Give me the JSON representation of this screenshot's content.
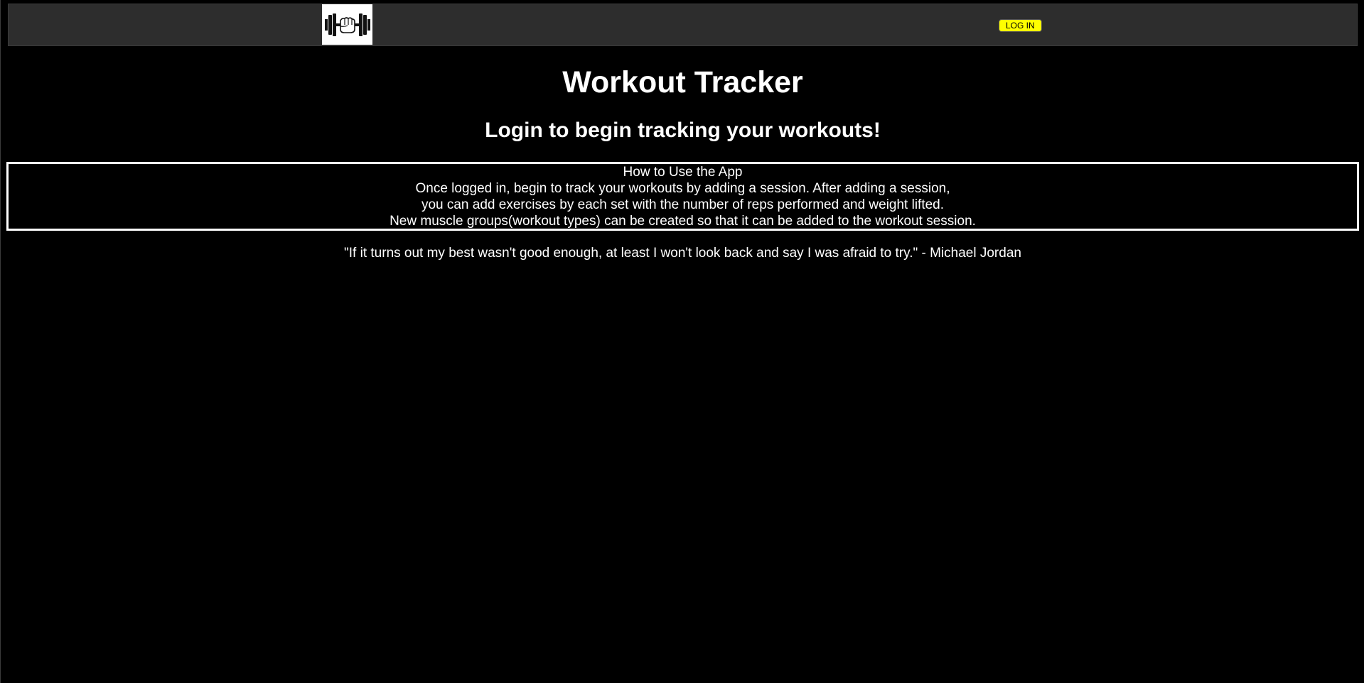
{
  "navbar": {
    "logo_icon": "dumbbell-fist-icon",
    "login_label": "LOG IN",
    "login_color": "#ffff00",
    "background": "#2d2d2d"
  },
  "main": {
    "title": "Workout Tracker",
    "subtitle": "Login to begin tracking your workouts!"
  },
  "howto": {
    "heading": "How to Use the App",
    "lines": [
      "Once logged in, begin to track your workouts by adding a session. After adding a session,",
      "you can add exercises by each set with the number of reps performed and weight lifted.",
      "New muscle groups(workout types) can be created so that it can be added to the workout session."
    ]
  },
  "quote": {
    "text": "\"If it turns out my best wasn't good enough, at least I won't look back and say I was afraid to try.\" - Michael Jordan"
  }
}
